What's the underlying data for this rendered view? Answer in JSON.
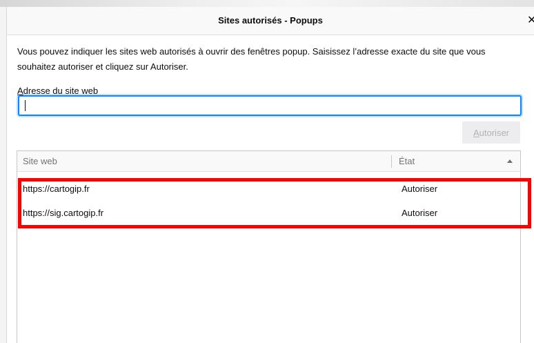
{
  "dialog": {
    "title": "Sites autorisés - Popups",
    "close_glyph": "✕",
    "description": "Vous pouvez indiquer les sites web autorisés à ouvrir des fenêtres popup. Saisissez l’adresse exacte du site que vous souhaitez autoriser et cliquez sur Autoriser.",
    "address_label_key": "A",
    "address_label_rest": "dresse du site web",
    "address_value": "",
    "allow_button": "Autoriser",
    "allow_button_enabled": false
  },
  "table": {
    "columns": [
      "Site web",
      "État"
    ],
    "sort_indicator": "ascending",
    "rows": [
      {
        "site": "https://cartogip.fr",
        "status": "Autoriser"
      },
      {
        "site": "https://sig.cartogip.fr",
        "status": "Autoriser"
      }
    ]
  },
  "annotation": {
    "highlight_color": "#ff0000"
  },
  "colors": {
    "accent": "#0a84ff",
    "disabled_text": "#b1b1b3"
  }
}
